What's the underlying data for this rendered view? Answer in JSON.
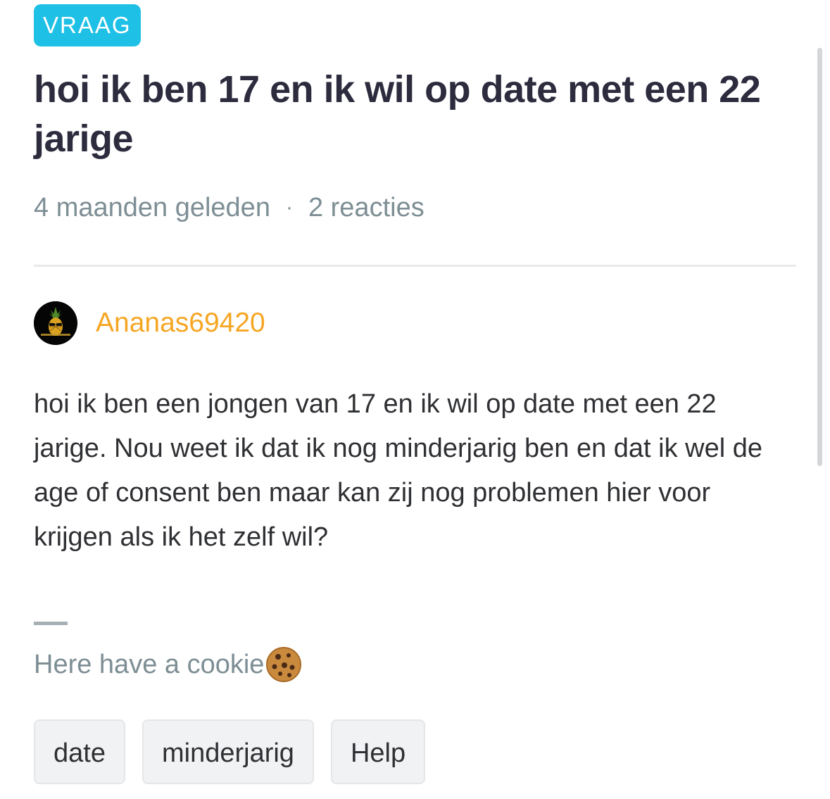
{
  "post": {
    "badge": "VRAAG",
    "title": "hoi ik ben 17 en ik wil op date met een 22 jarige",
    "time_ago": "4 maanden geleden",
    "separator": "·",
    "reactions": "2 reacties",
    "author": {
      "name": "Ananas69420",
      "avatar_icon": "pineapple-avatar-icon"
    },
    "body": "hoi ik ben een jongen van 17 en ik wil op date met een 22 jarige. Nou weet ik dat ik nog minderjarig ben en dat ik wel de age of consent ben maar kan zij nog problemen hier voor krijgen als ik het zelf wil?",
    "signature": "Here have a cookie",
    "signature_icon": "cookie-icon",
    "tags": [
      {
        "label": "date"
      },
      {
        "label": "minderjarig"
      },
      {
        "label": "Help"
      }
    ]
  },
  "colors": {
    "badge": "#1ec0e6",
    "author": "#f6a623",
    "meta": "#7d8e94",
    "title": "#2c2c3e"
  }
}
